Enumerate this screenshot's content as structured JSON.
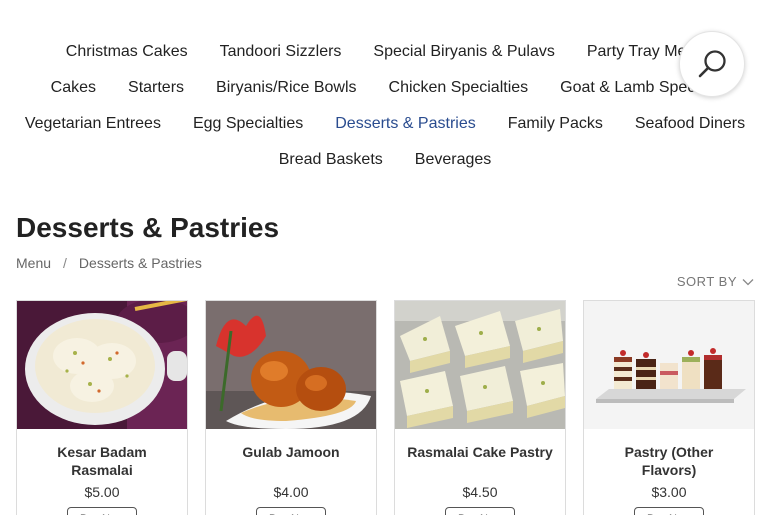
{
  "categories": {
    "row1": [
      "Christmas Cakes",
      "Tandoori Sizzlers",
      "Special Biryanis & Pulavs",
      "Party Tray Menu"
    ],
    "row2": [
      "Cakes",
      "Starters",
      "Biryanis/Rice Bowls",
      "Chicken Specialties",
      "Goat & Lamb Specials"
    ],
    "row3": [
      "Vegetarian Entrees",
      "Egg Specialties",
      "Desserts & Pastries",
      "Family Packs",
      "Seafood Diners"
    ],
    "row4": [
      "Bread Baskets",
      "Beverages"
    ],
    "active": "Desserts & Pastries"
  },
  "search": {
    "icon": "search-icon"
  },
  "page": {
    "title": "Desserts & Pastries",
    "breadcrumb": [
      "Menu",
      "Desserts & Pastries"
    ],
    "breadcrumb_separator": "/",
    "sort_label": "SORT BY"
  },
  "products": [
    {
      "name": "Kesar Badam Rasmalai",
      "price": "$5.00",
      "button": "Buy Now"
    },
    {
      "name": "Gulab Jamoon",
      "price": "$4.00",
      "button": "Buy Now"
    },
    {
      "name": "Rasmalai Cake Pastry",
      "price": "$4.50",
      "button": "Buy Now"
    },
    {
      "name": "Pastry (Other Flavors)",
      "price": "$3.00",
      "button": "Buy Now"
    }
  ],
  "colors": {
    "active_link": "#2a4c8f",
    "text": "#222222",
    "muted": "#666666"
  }
}
